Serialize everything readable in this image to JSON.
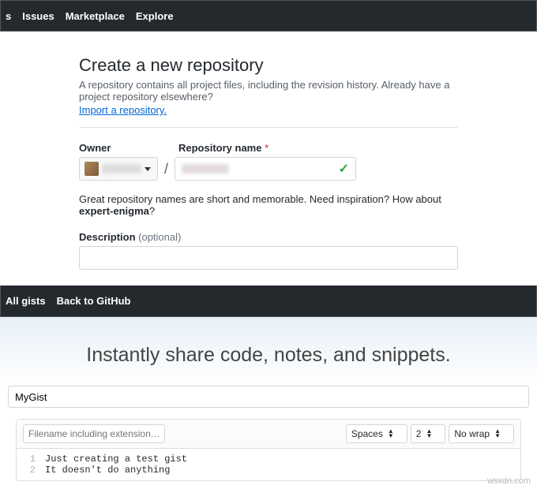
{
  "topnav": {
    "items": [
      "s",
      "Issues",
      "Marketplace",
      "Explore"
    ]
  },
  "create": {
    "title": "Create a new repository",
    "subtitle": "A repository contains all project files, including the revision history. Already have a project repository elsewhere?",
    "import_link": "Import a repository.",
    "owner_label": "Owner",
    "repo_label": "Repository name",
    "hint_prefix": "Great repository names are short and memorable. Need inspiration? How about ",
    "hint_suggestion": "expert-enigma",
    "hint_suffix": "?",
    "desc_label": "Description",
    "desc_optional": "(optional)"
  },
  "gistnav": {
    "items": [
      "All gists",
      "Back to GitHub"
    ]
  },
  "gist": {
    "hero": "Instantly share code, notes, and snippets.",
    "description_value": "MyGist",
    "filename_placeholder": "Filename including extension…",
    "indent_mode": "Spaces",
    "indent_size": "2",
    "wrap_mode": "No wrap",
    "lines": [
      {
        "n": "1",
        "t": "Just creating a test gist"
      },
      {
        "n": "2",
        "t": "It doesn't do anything"
      }
    ]
  },
  "watermark": "wsxdn.com"
}
